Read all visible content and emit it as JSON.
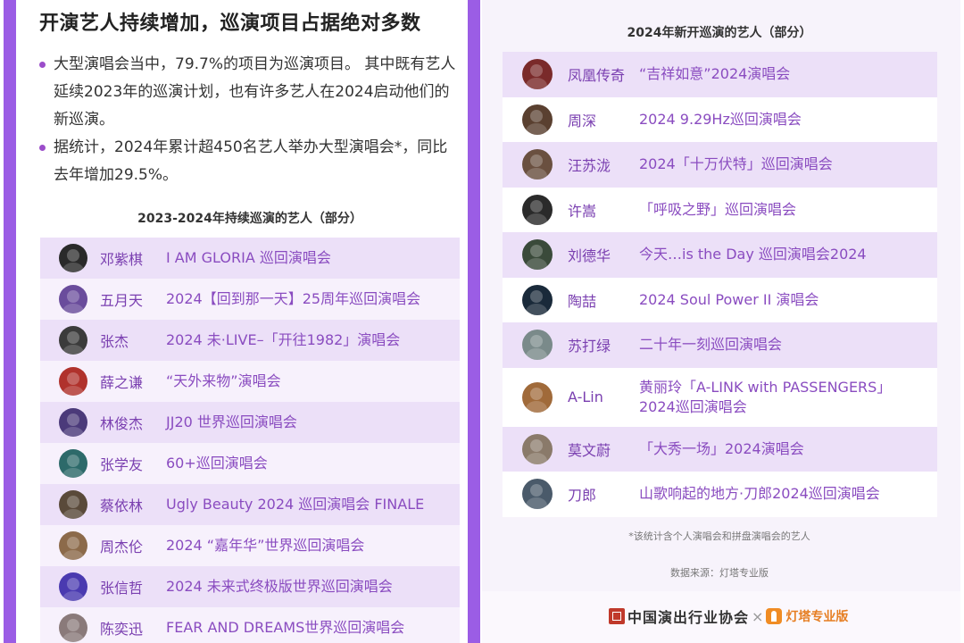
{
  "left": {
    "headline": "开演艺人持续增加，巡演项目占据绝对多数",
    "bullets": [
      "大型演唱会当中，79.7%的项目为巡演项目。 其中既有艺人延续2023年的巡演计划，也有许多艺人在2024启动他们的新巡演。",
      "据统计，2024年累计超450名艺人举办大型演唱会*，同比去年增加29.5%。"
    ],
    "section_title": "2023-2024年持续巡演的艺人（部分）",
    "rows": [
      {
        "name": "邓紫棋",
        "concert": "I AM GLORIA 巡回演唱会",
        "avatar_color": "#2a2a2a"
      },
      {
        "name": "五月天",
        "concert": "2024【回到那一天】25周年巡回演唱会",
        "avatar_color": "#6a4c9c"
      },
      {
        "name": "张杰",
        "concert": "2024 未·LIVE–「开往1982」演唱会",
        "avatar_color": "#3b3b3b"
      },
      {
        "name": "薛之谦",
        "concert": "“天外来物”演唱会",
        "avatar_color": "#b0322c"
      },
      {
        "name": "林俊杰",
        "concert": "JJ20 世界巡回演唱会",
        "avatar_color": "#4b3a7a"
      },
      {
        "name": "张学友",
        "concert": "60+巡回演唱会",
        "avatar_color": "#2d6a6a"
      },
      {
        "name": "蔡依林",
        "concert": "Ugly Beauty 2024 巡回演唱会 FINALE",
        "avatar_color": "#5a4a3a"
      },
      {
        "name": "周杰伦",
        "concert": "2024 “嘉年华”世界巡回演唱会",
        "avatar_color": "#8c6a4a"
      },
      {
        "name": "张信哲",
        "concert": "2024 未来式终极版世界巡回演唱会",
        "avatar_color": "#4a3ab0"
      },
      {
        "name": "陈奕迅",
        "concert": "FEAR AND DREAMS世界巡回演唱会",
        "avatar_color": "#8a7a7a"
      }
    ]
  },
  "right": {
    "section_title": "2024年新开巡演的艺人（部分）",
    "rows": [
      {
        "name": "凤凰传奇",
        "concert": "“吉祥如意”2024演唱会",
        "concert_line2": "",
        "avatar_color": "#7a2a2a"
      },
      {
        "name": "周深",
        "concert": "2024 9.29Hz巡回演唱会",
        "concert_line2": "",
        "avatar_color": "#5a4030"
      },
      {
        "name": "汪苏泷",
        "concert": "2024「十万伏特」巡回演唱会",
        "concert_line2": "",
        "avatar_color": "#6a5040"
      },
      {
        "name": "许嵩",
        "concert": "「呼吸之野」巡回演唱会",
        "concert_line2": "",
        "avatar_color": "#2a2a2a"
      },
      {
        "name": "刘德华",
        "concert": "今天…is the Day 巡回演唱会2024",
        "concert_line2": "",
        "avatar_color": "#3a4a3a"
      },
      {
        "name": "陶喆",
        "concert": "2024 Soul Power II 演唱会",
        "concert_line2": "",
        "avatar_color": "#1a2a3a"
      },
      {
        "name": "苏打绿",
        "concert": "二十年一刻巡回演唱会",
        "concert_line2": "",
        "avatar_color": "#7a8a8a"
      },
      {
        "name": "A-Lin",
        "concert": "黄丽玲「A-LINK with PASSENGERS」",
        "concert_line2": "2024巡回演唱会",
        "avatar_color": "#a06a3a"
      },
      {
        "name": "莫文蔚",
        "concert": "「大秀一场」2024演唱会",
        "concert_line2": "",
        "avatar_color": "#8a7a6a"
      },
      {
        "name": "刀郎",
        "concert": "山歌响起的地方·刀郎2024巡回演唱会",
        "concert_line2": "",
        "avatar_color": "#4a5a6a"
      }
    ],
    "footnote_stat": "*该统计含个人演唱会和拼盘演唱会的艺人",
    "footnote_source": "数据来源：灯塔专业版",
    "logos": {
      "association": "中国演出行业协会",
      "separator": "×",
      "dengta": "灯塔专业版"
    }
  },
  "colors": {
    "accent_bar": "#9b5de5",
    "row_odd": "#ece0f8",
    "row_even": "#f7f1fc",
    "text_purple": "#8a4cc0"
  }
}
